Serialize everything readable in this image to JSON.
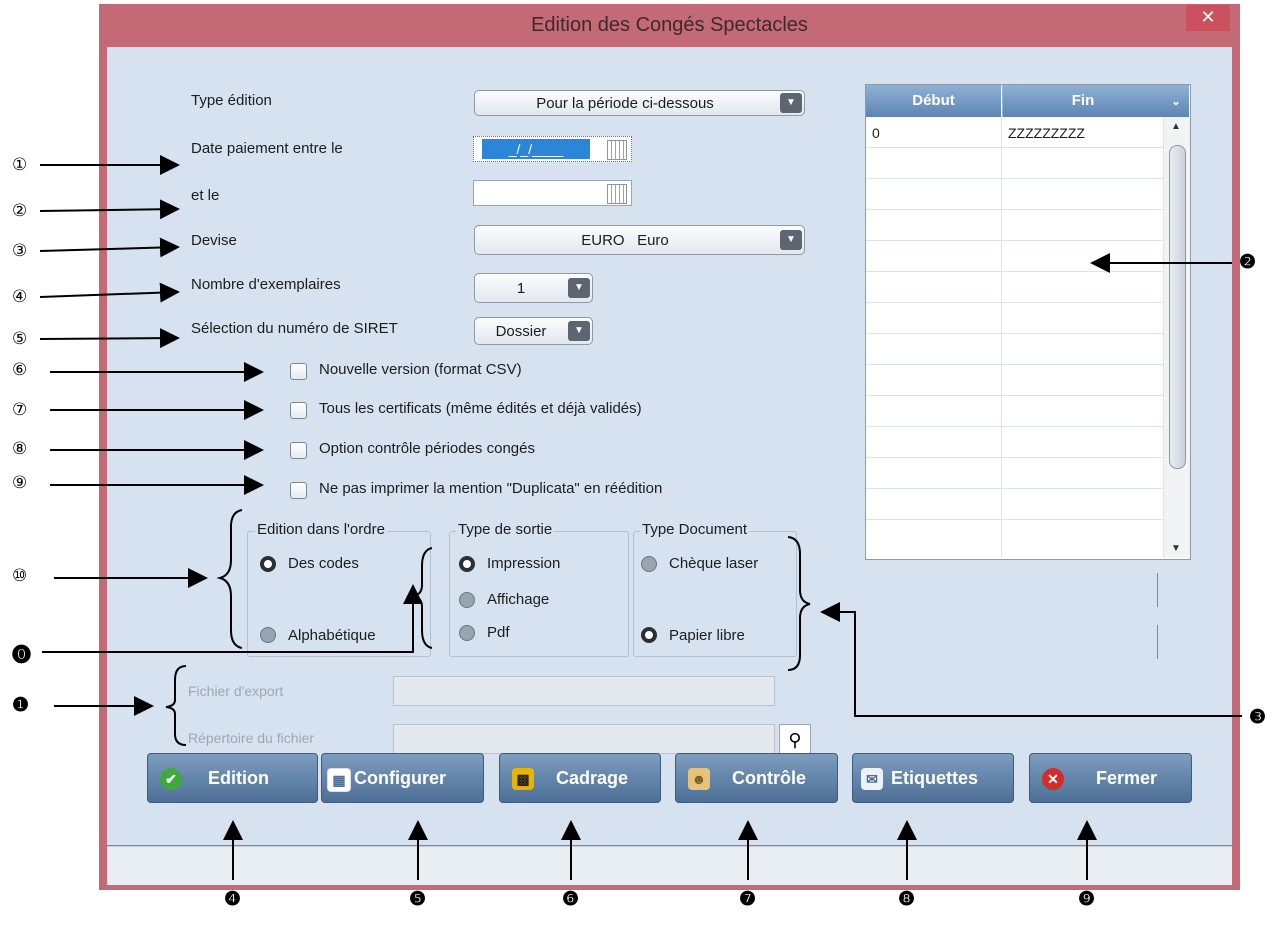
{
  "window": {
    "title": "Edition des Congés Spectacles",
    "close": "✕"
  },
  "form": {
    "type_edition": {
      "label": "Type édition",
      "value": "Pour la période ci-dessous"
    },
    "date_paiement": {
      "label": "Date paiement entre le",
      "value": " _/_/____ "
    },
    "et_le": {
      "label": "et le"
    },
    "devise": {
      "label": "Devise",
      "value": "EURO   Euro"
    },
    "nombre": {
      "label": "Nombre d'exemplaires",
      "value": "1"
    },
    "siret": {
      "label": "Sélection du numéro de SIRET",
      "value": "Dossier"
    },
    "checks": [
      {
        "label": "Nouvelle version (format CSV)",
        "checked": false
      },
      {
        "label": "Tous les certificats (même édités et déjà validés)",
        "checked": false
      },
      {
        "label": "Option contrôle périodes congés",
        "checked": false
      },
      {
        "label": "Ne pas imprimer la mention \"Duplicata\" en réédition",
        "checked": false
      }
    ],
    "ordre": {
      "title": "Edition dans l'ordre",
      "options": [
        "Des codes",
        "Alphabétique"
      ],
      "selected": 0
    },
    "sortie": {
      "title": "Type de sortie",
      "options": [
        "Impression",
        "Affichage",
        "Pdf"
      ],
      "selected": 0
    },
    "document": {
      "title": "Type Document",
      "options": [
        "Chèque laser",
        "Papier libre"
      ],
      "selected": 1
    },
    "fichier_export": {
      "label": "Fichier d'export"
    },
    "repertoire": {
      "label": "Répertoire du fichier"
    }
  },
  "grid": {
    "columns": [
      "Début",
      "Fin"
    ],
    "rows": [
      {
        "debut": "0",
        "fin": "ZZZZZZZZZ"
      }
    ]
  },
  "buttons": [
    {
      "label": "Edition",
      "icon": "check-icon"
    },
    {
      "label": "Configurer",
      "icon": "configure-icon"
    },
    {
      "label": "Cadrage",
      "icon": "framing-icon"
    },
    {
      "label": "Contrôle",
      "icon": "control-icon"
    },
    {
      "label": "Etiquettes",
      "icon": "labels-icon"
    },
    {
      "label": "Fermer",
      "icon": "close-icon"
    }
  ],
  "annotations": {
    "left": [
      "①",
      "②",
      "③",
      "④",
      "⑤",
      "⑥",
      "⑦",
      "⑧",
      "⑨",
      "⑩",
      "⓿",
      "❶"
    ],
    "right": [
      "❷",
      "❸"
    ],
    "bottom": [
      "❹",
      "❺",
      "❻",
      "❼",
      "❽",
      "❾"
    ]
  }
}
